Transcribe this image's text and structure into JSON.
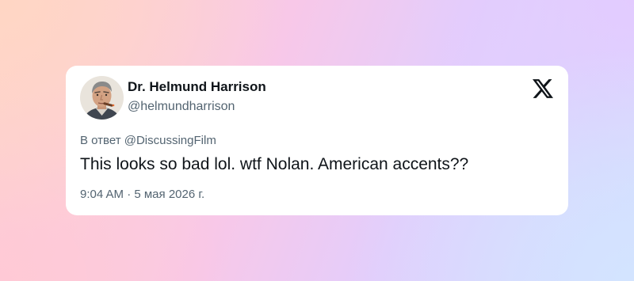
{
  "tweet": {
    "author_name": "Dr. Helmund Harrison",
    "author_handle": "@helmundharrison",
    "reply_to": "В ответ @DiscussingFilm",
    "text": "This looks so bad lol. wtf Nolan. American accents??",
    "timestamp": "9:04 AM · 5 мая 2026 г."
  },
  "icons": {
    "brand": "x-logo-icon"
  },
  "colors": {
    "text_primary": "#0f1419",
    "text_secondary": "#536471",
    "card_background": "#ffffff"
  }
}
